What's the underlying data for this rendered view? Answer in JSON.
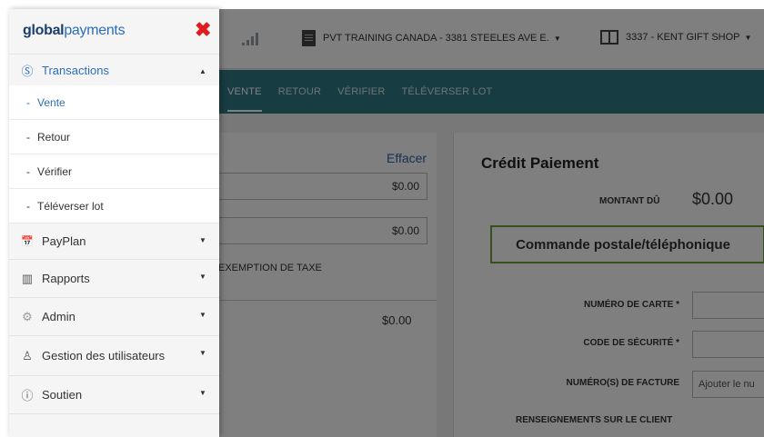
{
  "header": {
    "merchant": "PVT TRAINING CANADA - 3381 STEELES AVE E.",
    "terminal": "3337 - KENT GIFT SHOP"
  },
  "subnav": {
    "tabs": [
      {
        "label": "VENTE",
        "active": true
      },
      {
        "label": "RETOUR",
        "active": false
      },
      {
        "label": "VÉRIFIER",
        "active": false
      },
      {
        "label": "TÉLÉVERSER LOT",
        "active": false
      }
    ]
  },
  "left_panel": {
    "clear_label": "Effacer",
    "amount_1": "$0.00",
    "amount_2": "$0.00",
    "tax_exemption_label": "EXEMPTION DE TAXE",
    "total": "$0.00"
  },
  "payment_card": {
    "title": "Crédit Paiement",
    "amount_due_label": "MONTANT DÛ",
    "amount_due_value": "$0.00",
    "mode_button": "Commande postale/téléphonique",
    "card_number_label": "NUMÉRO DE CARTE *",
    "security_code_label": "CODE DE SÉCURITÉ *",
    "invoice_label": "NUMÉRO(S) DE FACTURE",
    "invoice_placeholder": "Ajouter le nu",
    "customer_info_label": "RENSEIGNEMENTS SUR LE CLIENT"
  },
  "drawer": {
    "logo_bold": "global",
    "logo_rest": "payments",
    "close_glyph": "✖",
    "menu": {
      "transactions": {
        "label": "Transactions",
        "icon": "dollar-circle-icon",
        "glyph": "Ⓢ"
      },
      "sub_items": [
        {
          "label": "Vente",
          "active": true
        },
        {
          "label": "Retour",
          "active": false
        },
        {
          "label": "Vérifier",
          "active": false
        },
        {
          "label": "Téléverser lot",
          "active": false
        }
      ],
      "payplan": {
        "label": "PayPlan",
        "icon": "calendar-icon",
        "glyph": "📅"
      },
      "reports": {
        "label": "Rapports",
        "icon": "bar-chart-icon",
        "glyph": "▥"
      },
      "admin": {
        "label": "Admin",
        "icon": "gear-icon",
        "glyph": "⚙"
      },
      "users": {
        "label": "Gestion des utilisateurs",
        "icon": "user-icon",
        "glyph": "♙"
      },
      "support": {
        "label": "Soutien",
        "icon": "info-icon",
        "glyph": "ⓘ"
      }
    },
    "dash": "-",
    "chevron_down": "▼",
    "chevron_up": "▲"
  },
  "colors": {
    "accent": "#2a6ebd",
    "close": "#e01b22",
    "subnav": "#2f7a86",
    "mode_border": "#6fa23a"
  }
}
